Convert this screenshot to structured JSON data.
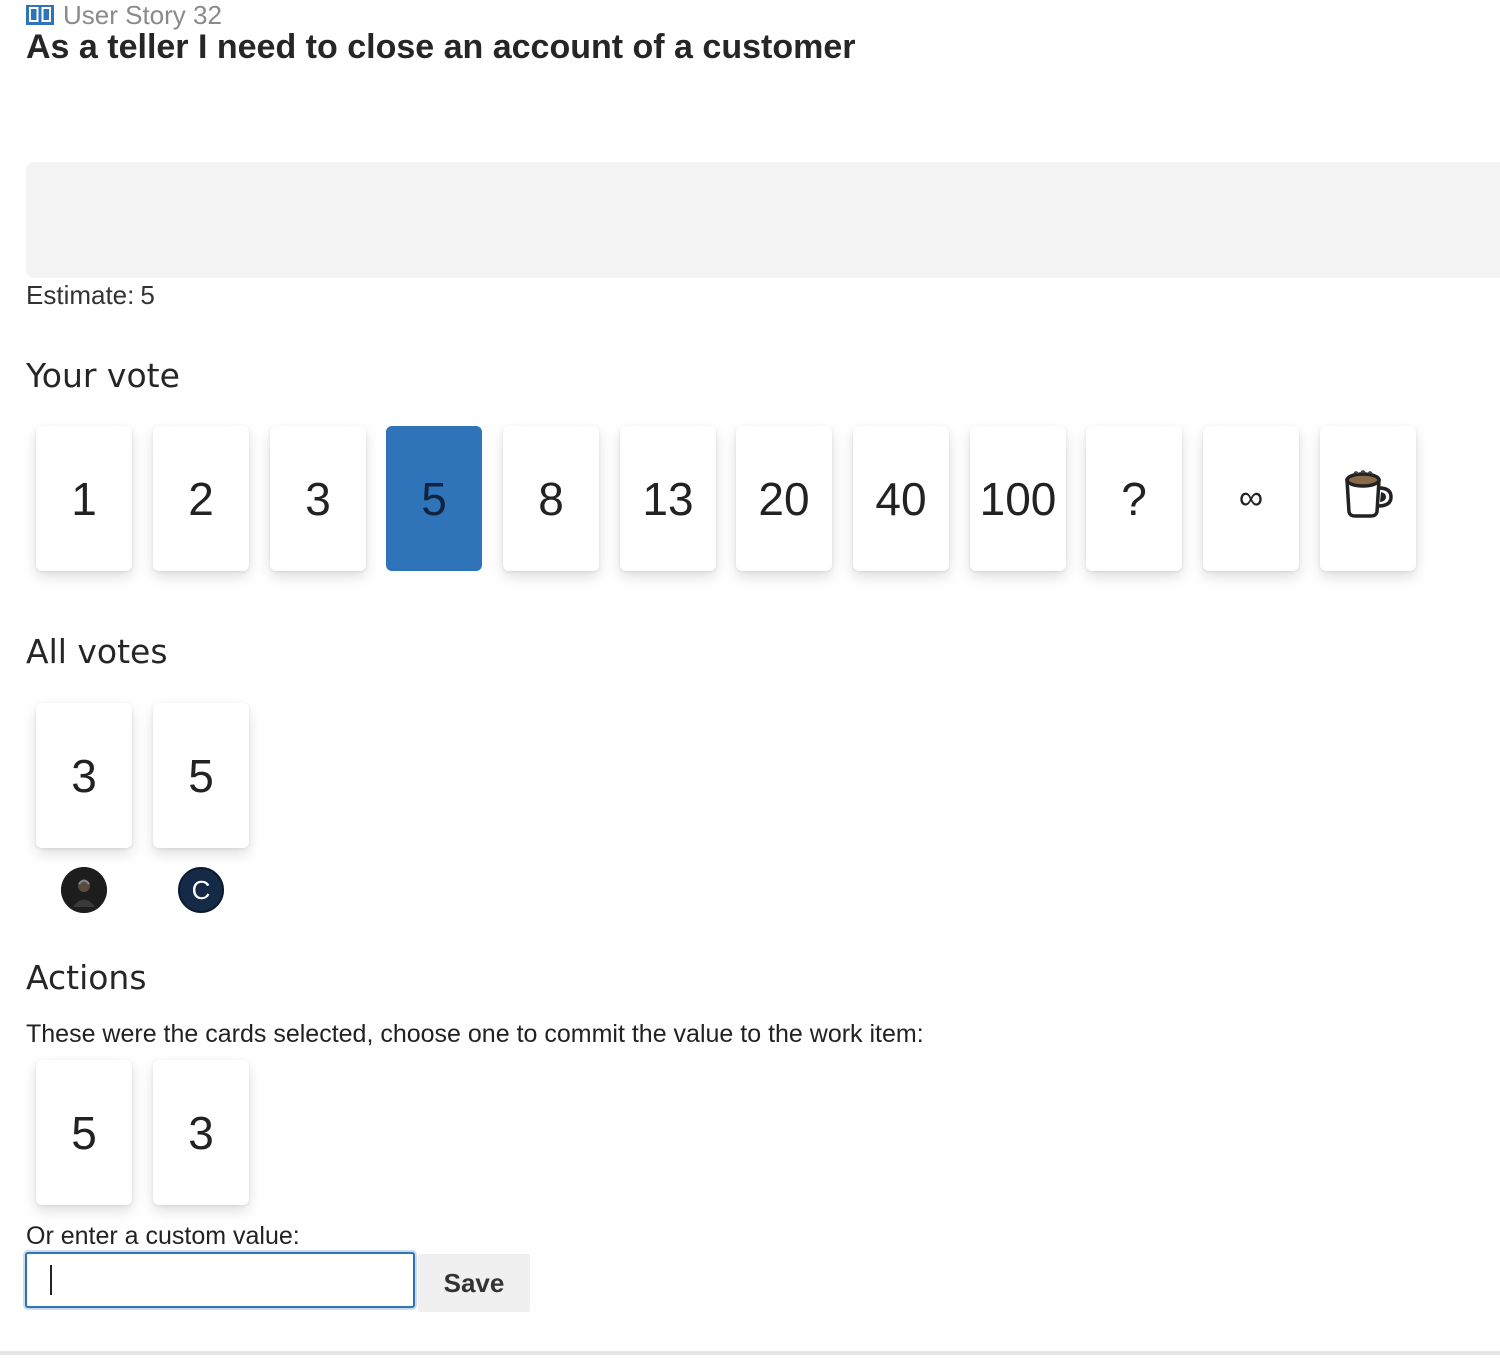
{
  "workitem": {
    "type_label": "User Story 32",
    "type_icon": "book-icon",
    "title": "As a teller I need to close an account of a customer",
    "estimate_label": "Estimate:",
    "estimate_value": "5"
  },
  "your_vote": {
    "heading": "Your vote",
    "selected": "5",
    "selected_color": "#2f73b8",
    "cards": [
      "1",
      "2",
      "3",
      "5",
      "8",
      "13",
      "20",
      "40",
      "100",
      "?",
      "∞",
      "coffee-cup-icon"
    ]
  },
  "all_votes": {
    "heading": "All votes",
    "votes": [
      {
        "value": "3",
        "avatar": "user-photo"
      },
      {
        "value": "5",
        "avatar_letter": "C"
      }
    ]
  },
  "actions": {
    "heading": "Actions",
    "description": "These were the cards selected, choose one to commit the value to the work item:",
    "cards": [
      "5",
      "3"
    ],
    "custom_label": "Or enter a custom value:",
    "custom_value": "",
    "save_label": "Save"
  }
}
